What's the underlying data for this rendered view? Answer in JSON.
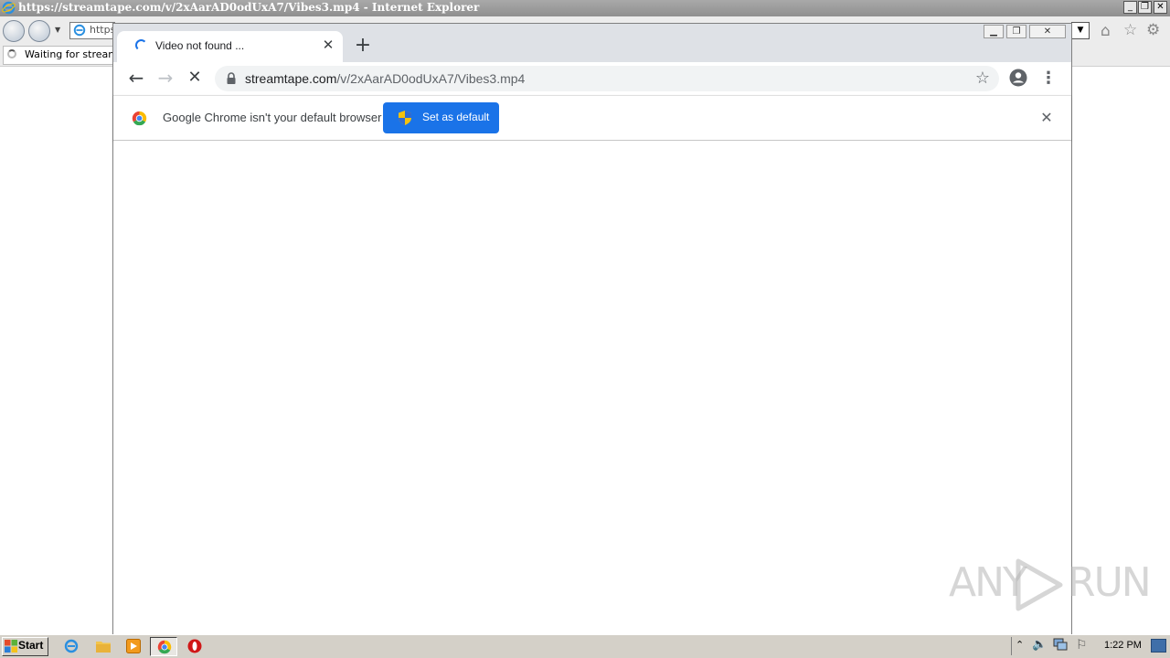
{
  "ie": {
    "title": "https://streamtape.com/v/2xAarAD0odUxA7/Vibes3.mp4 - Internet Explorer",
    "address_value": "https",
    "tab_status": "Waiting for streamta"
  },
  "chrome": {
    "tab_title": "Video not found ...",
    "url_host": "streamtape.com",
    "url_path": "/v/2xAarAD0odUxA7/Vibes3.mp4",
    "infobar_message": "Google Chrome isn't your default browser",
    "set_default_label": "Set as default",
    "accent_color": "#1a73e8",
    "loading": true
  },
  "watermark": {
    "left": "ANY",
    "right": "RUN"
  },
  "taskbar": {
    "start_label": "Start",
    "clock": "1:22 PM",
    "pinned": [
      "internet-explorer-icon",
      "explorer-folder-icon",
      "media-player-icon",
      "chrome-icon",
      "opera-icon"
    ]
  }
}
